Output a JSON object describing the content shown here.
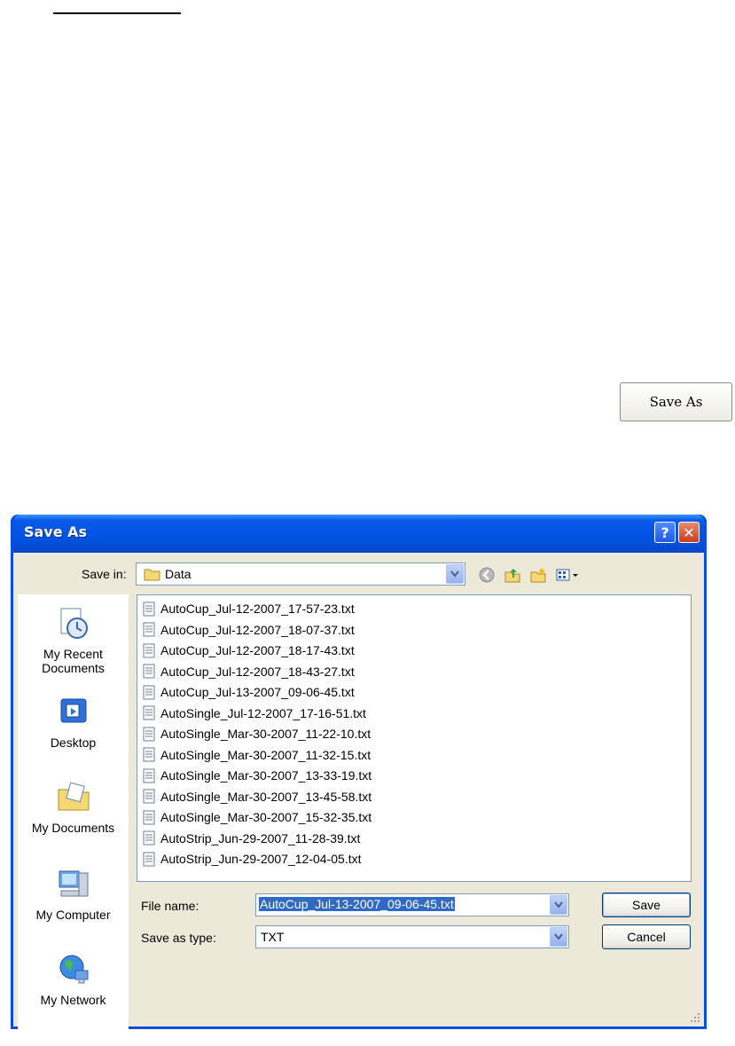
{
  "page": {
    "save_as_button_label": "Save As"
  },
  "dialog": {
    "title": "Save As",
    "help_glyph": "?",
    "close_glyph": "✕",
    "save_in_label": "Save in:",
    "save_in_value": "Data",
    "toolbar_icons": [
      "back-icon",
      "up-folder-icon",
      "new-folder-icon",
      "view-menu-icon"
    ],
    "places": [
      {
        "label_line1": "My Recent",
        "label_line2": "Documents",
        "icon": "recent-documents-icon"
      },
      {
        "label_line1": "Desktop",
        "label_line2": "",
        "icon": "desktop-icon"
      },
      {
        "label_line1": "My Documents",
        "label_line2": "",
        "icon": "my-documents-icon"
      },
      {
        "label_line1": "My Computer",
        "label_line2": "",
        "icon": "my-computer-icon"
      },
      {
        "label_line1": "My Network",
        "label_line2": "",
        "icon": "my-network-icon"
      }
    ],
    "files": [
      "AutoCup_Jul-12-2007_17-57-23.txt",
      "AutoCup_Jul-12-2007_18-07-37.txt",
      "AutoCup_Jul-12-2007_18-17-43.txt",
      "AutoCup_Jul-12-2007_18-43-27.txt",
      "AutoCup_Jul-13-2007_09-06-45.txt",
      "AutoSingle_Jul-12-2007_17-16-51.txt",
      "AutoSingle_Mar-30-2007_11-22-10.txt",
      "AutoSingle_Mar-30-2007_11-32-15.txt",
      "AutoSingle_Mar-30-2007_13-33-19.txt",
      "AutoSingle_Mar-30-2007_13-45-58.txt",
      "AutoSingle_Mar-30-2007_15-32-35.txt",
      "AutoStrip_Jun-29-2007_11-28-39.txt",
      "AutoStrip_Jun-29-2007_12-04-05.txt"
    ],
    "file_name_label": "File name:",
    "file_name_value": "AutoCup_Jul-13-2007_09-06-45.txt",
    "save_type_label": "Save as type:",
    "save_type_value": "TXT",
    "save_button": "Save",
    "cancel_button": "Cancel"
  },
  "colors": {
    "titlebar": "#0053e2",
    "dialog_face": "#ece9d8",
    "selection": "#316ac5"
  }
}
